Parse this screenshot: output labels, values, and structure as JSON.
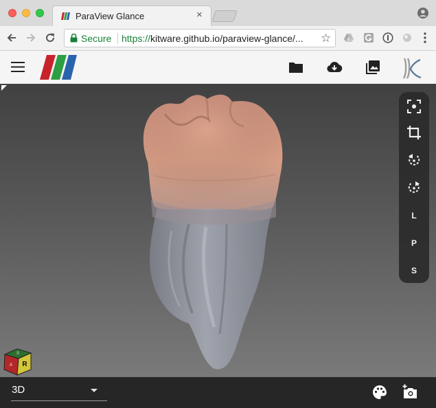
{
  "browser": {
    "tab_title": "ParaView Glance",
    "tab_close": "×",
    "secure_label": "Secure",
    "url_scheme": "https://",
    "url_host": "kitware.github.io",
    "url_path": "/paraview-glance/...",
    "star_glyph": "☆"
  },
  "app": {
    "name": "ParaView Glance",
    "colors": {
      "logo_red": "#c8232c",
      "logo_green": "#2e9e44",
      "logo_blue": "#2a63ad",
      "header_bg": "#f5f5f5",
      "viewport_top": "#414141",
      "viewport_bottom": "#7a7a7a",
      "footer_bg": "#262626"
    },
    "header_icons": [
      "menu-icon",
      "folder-icon",
      "cloud-download-icon",
      "image-icon",
      "kitware-logo"
    ]
  },
  "view_tools": {
    "icons": [
      "reset-camera-icon",
      "crop-icon",
      "rotate-left-icon",
      "rotate-right-icon"
    ],
    "axis_buttons": [
      {
        "label": "L"
      },
      {
        "label": "P"
      },
      {
        "label": "S"
      }
    ]
  },
  "orientation_cube": {
    "face_label": "R",
    "top_label": "S",
    "side_label": "A"
  },
  "footer": {
    "view_type": "3D",
    "icons": [
      "palette-icon",
      "screenshot-icon"
    ]
  }
}
